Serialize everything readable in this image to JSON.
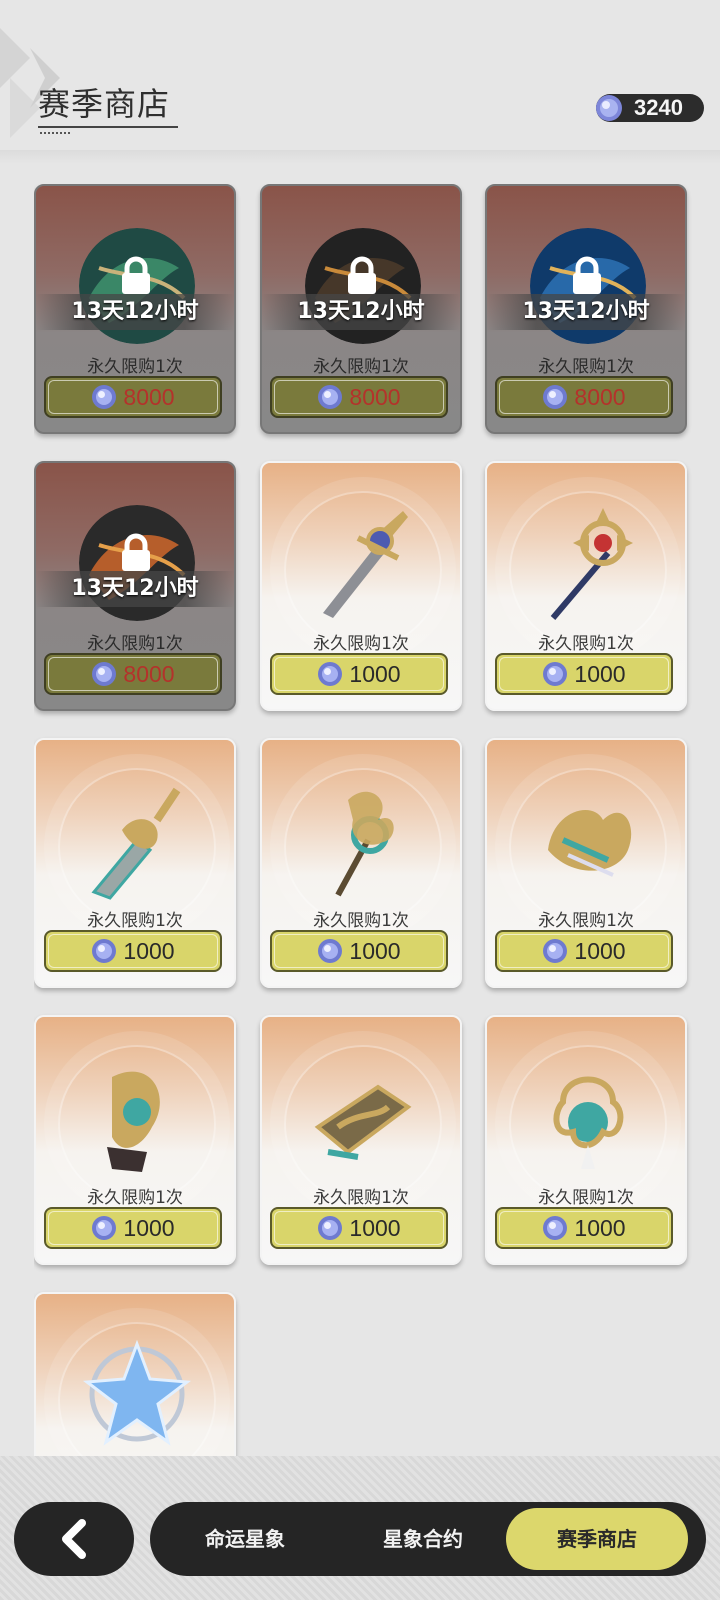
{
  "header": {
    "title": "赛季商店",
    "currency_amount": "3240",
    "currency_icon": "stardust-coin-icon"
  },
  "items": [
    {
      "state": "locked",
      "art": "emblem-green-dragon",
      "timer": "13天12小时",
      "limit": "永久限购1次",
      "price": "8000"
    },
    {
      "state": "locked",
      "art": "emblem-dark-gold",
      "timer": "13天12小时",
      "limit": "永久限购1次",
      "price": "8000"
    },
    {
      "state": "locked",
      "art": "emblem-blue-dragon",
      "timer": "13天12小时",
      "limit": "永久限购1次",
      "price": "8000"
    },
    {
      "state": "locked",
      "art": "emblem-orange-phoenix",
      "timer": "13天12小时",
      "limit": "永久限购1次",
      "price": "8000"
    },
    {
      "state": "available",
      "art": "sword-icon",
      "limit": "永久限购1次",
      "price": "1000"
    },
    {
      "state": "available",
      "art": "staff-icon",
      "limit": "永久限购1次",
      "price": "1000"
    },
    {
      "state": "available",
      "art": "greatsword-icon",
      "limit": "永久限购1次",
      "price": "1000"
    },
    {
      "state": "available",
      "art": "scepter-icon",
      "limit": "永久限购1次",
      "price": "1000"
    },
    {
      "state": "available",
      "art": "polearm-icon",
      "limit": "永久限购1次",
      "price": "1000"
    },
    {
      "state": "available",
      "art": "bow-icon",
      "limit": "永久限购1次",
      "price": "1000"
    },
    {
      "state": "available",
      "art": "book-icon",
      "limit": "永久限购1次",
      "price": "1000"
    },
    {
      "state": "available",
      "art": "catalyst-orb-icon",
      "limit": "永久限购1次",
      "price": "1000"
    },
    {
      "state": "available",
      "art": "crystal-star-icon",
      "limit": "",
      "price": ""
    }
  ],
  "nav": {
    "back_icon": "chevron-left-icon",
    "tabs": [
      {
        "label": "命运星象",
        "active": false
      },
      {
        "label": "星象合约",
        "active": false
      },
      {
        "label": "赛季商店",
        "active": true
      }
    ]
  },
  "colors": {
    "accent": "#dcd76c",
    "price_locked": "#b4322b",
    "dark": "#252525"
  }
}
